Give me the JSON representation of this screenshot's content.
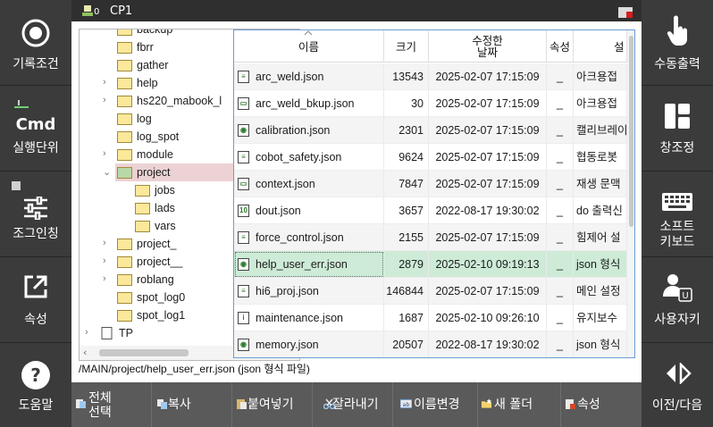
{
  "status_bar": {
    "num": "0",
    "title": "CP1"
  },
  "left_panel": [
    {
      "label": "기록조건",
      "icon": "record-circle-icon"
    },
    {
      "label": "실행단위",
      "icon": "cmd-icon",
      "icon_text": "Cmd"
    },
    {
      "label": "조그인칭",
      "icon": "sliders-icon"
    },
    {
      "label": "속성",
      "icon": "external-link-icon"
    },
    {
      "label": "도움말",
      "icon": "help-icon"
    }
  ],
  "right_panel": [
    {
      "label": "수동출력",
      "icon": "hand-pointer-icon"
    },
    {
      "label": "창조정",
      "icon": "window-layout-icon"
    },
    {
      "label": "소프트\n키보드",
      "icon": "keyboard-icon"
    },
    {
      "label": "사용자키",
      "icon": "user-key-icon"
    },
    {
      "label": "이전/다음",
      "icon": "prev-next-icon"
    }
  ],
  "tree": {
    "items": [
      {
        "name": "backup",
        "expander": "",
        "selected": false,
        "indent": 1
      },
      {
        "name": "fbrr",
        "expander": "",
        "selected": false,
        "indent": 1
      },
      {
        "name": "gather",
        "expander": "",
        "selected": false,
        "indent": 1
      },
      {
        "name": "help",
        "expander": "›",
        "selected": false,
        "indent": 1
      },
      {
        "name": "hs220_mabook_l",
        "expander": "›",
        "selected": false,
        "indent": 1
      },
      {
        "name": "log",
        "expander": "",
        "selected": false,
        "indent": 1
      },
      {
        "name": "log_spot",
        "expander": "",
        "selected": false,
        "indent": 1
      },
      {
        "name": "module",
        "expander": "›",
        "selected": false,
        "indent": 1
      },
      {
        "name": "project",
        "expander": "⌄",
        "selected": true,
        "indent": 1
      },
      {
        "name": "jobs",
        "expander": "",
        "selected": false,
        "indent": 2
      },
      {
        "name": "lads",
        "expander": "",
        "selected": false,
        "indent": 2
      },
      {
        "name": "vars",
        "expander": "",
        "selected": false,
        "indent": 2
      },
      {
        "name": "project_",
        "expander": "›",
        "selected": false,
        "indent": 1
      },
      {
        "name": "project__",
        "expander": "›",
        "selected": false,
        "indent": 1
      },
      {
        "name": "roblang",
        "expander": "›",
        "selected": false,
        "indent": 1
      },
      {
        "name": "spot_log0",
        "expander": "",
        "selected": false,
        "indent": 1
      },
      {
        "name": "spot_log1",
        "expander": "",
        "selected": false,
        "indent": 1
      },
      {
        "name": "TP",
        "expander": "›",
        "selected": false,
        "indent": 0
      }
    ]
  },
  "list": {
    "headers": [
      "이름",
      "크기",
      "수정한\n날짜",
      "속성",
      "설"
    ],
    "rows": [
      {
        "name": "arc_weld.json",
        "size": "13543",
        "date": "2025-02-07 17:15:09",
        "attr": "_",
        "desc": "아크용접",
        "icon": "≡"
      },
      {
        "name": "arc_weld_bkup.json",
        "size": "30",
        "date": "2025-02-07 17:15:09",
        "attr": "_",
        "desc": "아크용접",
        "icon": "▭"
      },
      {
        "name": "calibration.json",
        "size": "2301",
        "date": "2025-02-07 17:15:09",
        "attr": "_",
        "desc": "캘리브레이",
        "icon": "◉"
      },
      {
        "name": "cobot_safety.json",
        "size": "9624",
        "date": "2025-02-07 17:15:09",
        "attr": "_",
        "desc": "협동로봇",
        "icon": "≡"
      },
      {
        "name": "context.json",
        "size": "7847",
        "date": "2025-02-07 17:15:09",
        "attr": "_",
        "desc": "재생 문맥",
        "icon": "▭"
      },
      {
        "name": "dout.json",
        "size": "3657",
        "date": "2022-08-17 19:30:02",
        "attr": "_",
        "desc": "do 출력신",
        "icon": "10"
      },
      {
        "name": "force_control.json",
        "size": "2155",
        "date": "2025-02-07 17:15:09",
        "attr": "_",
        "desc": "힘제어 설",
        "icon": "≡"
      },
      {
        "name": "help_user_err.json",
        "size": "2879",
        "date": "2025-02-10 09:19:13",
        "attr": "_",
        "desc": "json 형식",
        "icon": "◉"
      },
      {
        "name": "hi6_proj.json",
        "size": "146844",
        "date": "2025-02-07 17:15:09",
        "attr": "_",
        "desc": "메인 설정",
        "icon": "≡"
      },
      {
        "name": "maintenance.json",
        "size": "1687",
        "date": "2025-02-10 09:26:10",
        "attr": "_",
        "desc": "유지보수",
        "icon": "i"
      },
      {
        "name": "memory.json",
        "size": "20507",
        "date": "2022-08-17 19:30:02",
        "attr": "_",
        "desc": "json 형식",
        "icon": "◉"
      }
    ],
    "selected_index": 7
  },
  "path": "/MAIN/project/help_user_err.json  (json 형식 파일)",
  "bottom_bar": [
    {
      "label": "전체\n선택",
      "icon": "select-all-icon"
    },
    {
      "label": "복사",
      "icon": "copy-icon"
    },
    {
      "label": "붙여넣기",
      "icon": "paste-icon"
    },
    {
      "label": "잘라내기",
      "icon": "cut-icon"
    },
    {
      "label": "이름변경",
      "icon": "rename-icon"
    },
    {
      "label": "새 폴더",
      "icon": "new-folder-icon"
    },
    {
      "label": "속성",
      "icon": "properties-icon"
    }
  ],
  "colors": {
    "selected_tree": "#ecd2d4",
    "selected_row": "#cdebd7",
    "folder": "#fbe89a",
    "selected_folder": "#b8d8a8"
  }
}
